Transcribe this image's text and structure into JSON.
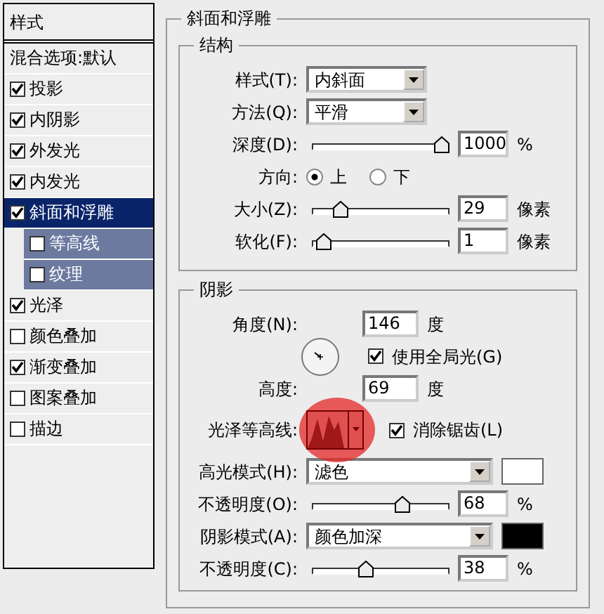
{
  "sidebar": {
    "title": "样式",
    "items": [
      {
        "label": "混合选项:默认",
        "kind": "header",
        "selected": false
      },
      {
        "label": "投影",
        "kind": "check",
        "checked": true,
        "selected": false
      },
      {
        "label": "内阴影",
        "kind": "check",
        "checked": true,
        "selected": false
      },
      {
        "label": "外发光",
        "kind": "check",
        "checked": true,
        "selected": false
      },
      {
        "label": "内发光",
        "kind": "check",
        "checked": true,
        "selected": false
      },
      {
        "label": "斜面和浮雕",
        "kind": "check",
        "checked": true,
        "selected": true,
        "children": [
          {
            "label": "等高线",
            "kind": "check",
            "checked": false
          },
          {
            "label": "纹理",
            "kind": "check",
            "checked": false
          }
        ]
      },
      {
        "label": "光泽",
        "kind": "check",
        "checked": true,
        "selected": false
      },
      {
        "label": "颜色叠加",
        "kind": "check",
        "checked": false,
        "selected": false
      },
      {
        "label": "渐变叠加",
        "kind": "check",
        "checked": true,
        "selected": false
      },
      {
        "label": "图案叠加",
        "kind": "check",
        "checked": false,
        "selected": false
      },
      {
        "label": "描边",
        "kind": "check",
        "checked": false,
        "selected": false
      }
    ]
  },
  "panel": {
    "title": "斜面和浮雕",
    "structure": {
      "title": "结构",
      "rows": [
        {
          "kind": "select",
          "label": "样式(T):",
          "value": "内斜面"
        },
        {
          "kind": "select",
          "label": "方法(Q):",
          "value": "平滑"
        },
        {
          "kind": "slider",
          "label": "深度(D):",
          "level": 1.0,
          "value": "1000",
          "unit": "%"
        },
        {
          "kind": "radio",
          "label": "方向:",
          "options": [
            {
              "label": "上",
              "selected": true
            },
            {
              "label": "下",
              "selected": false
            }
          ]
        },
        {
          "kind": "slider",
          "label": "大小(Z):",
          "level": 0.17,
          "value": "29",
          "unit": "像素"
        },
        {
          "kind": "slider",
          "label": "软化(F):",
          "level": 0.03,
          "value": "1",
          "unit": "像素"
        }
      ]
    },
    "shading": {
      "title": "阴影",
      "angle": {
        "label": "角度(N):",
        "value": "146",
        "unit": "度"
      },
      "global_light": {
        "label": "使用全局光(G)",
        "checked": true
      },
      "altitude": {
        "label": "高度:",
        "value": "69",
        "unit": "度"
      },
      "contour": {
        "label": "光泽等高线:"
      },
      "anti_alias": {
        "label": "消除锯齿(L)",
        "checked": true
      },
      "rows": [
        {
          "kind": "mode",
          "label": "高光模式(H):",
          "value": "滤色",
          "color": "#ffffff"
        },
        {
          "kind": "slider",
          "label": "不透明度(O):",
          "level": 0.68,
          "value": "68",
          "unit": "%"
        },
        {
          "kind": "mode",
          "label": "阴影模式(A):",
          "value": "颜色加深",
          "color": "#000000"
        },
        {
          "kind": "slider",
          "label": "不透明度(C):",
          "level": 0.38,
          "value": "38",
          "unit": "%"
        }
      ]
    }
  }
}
